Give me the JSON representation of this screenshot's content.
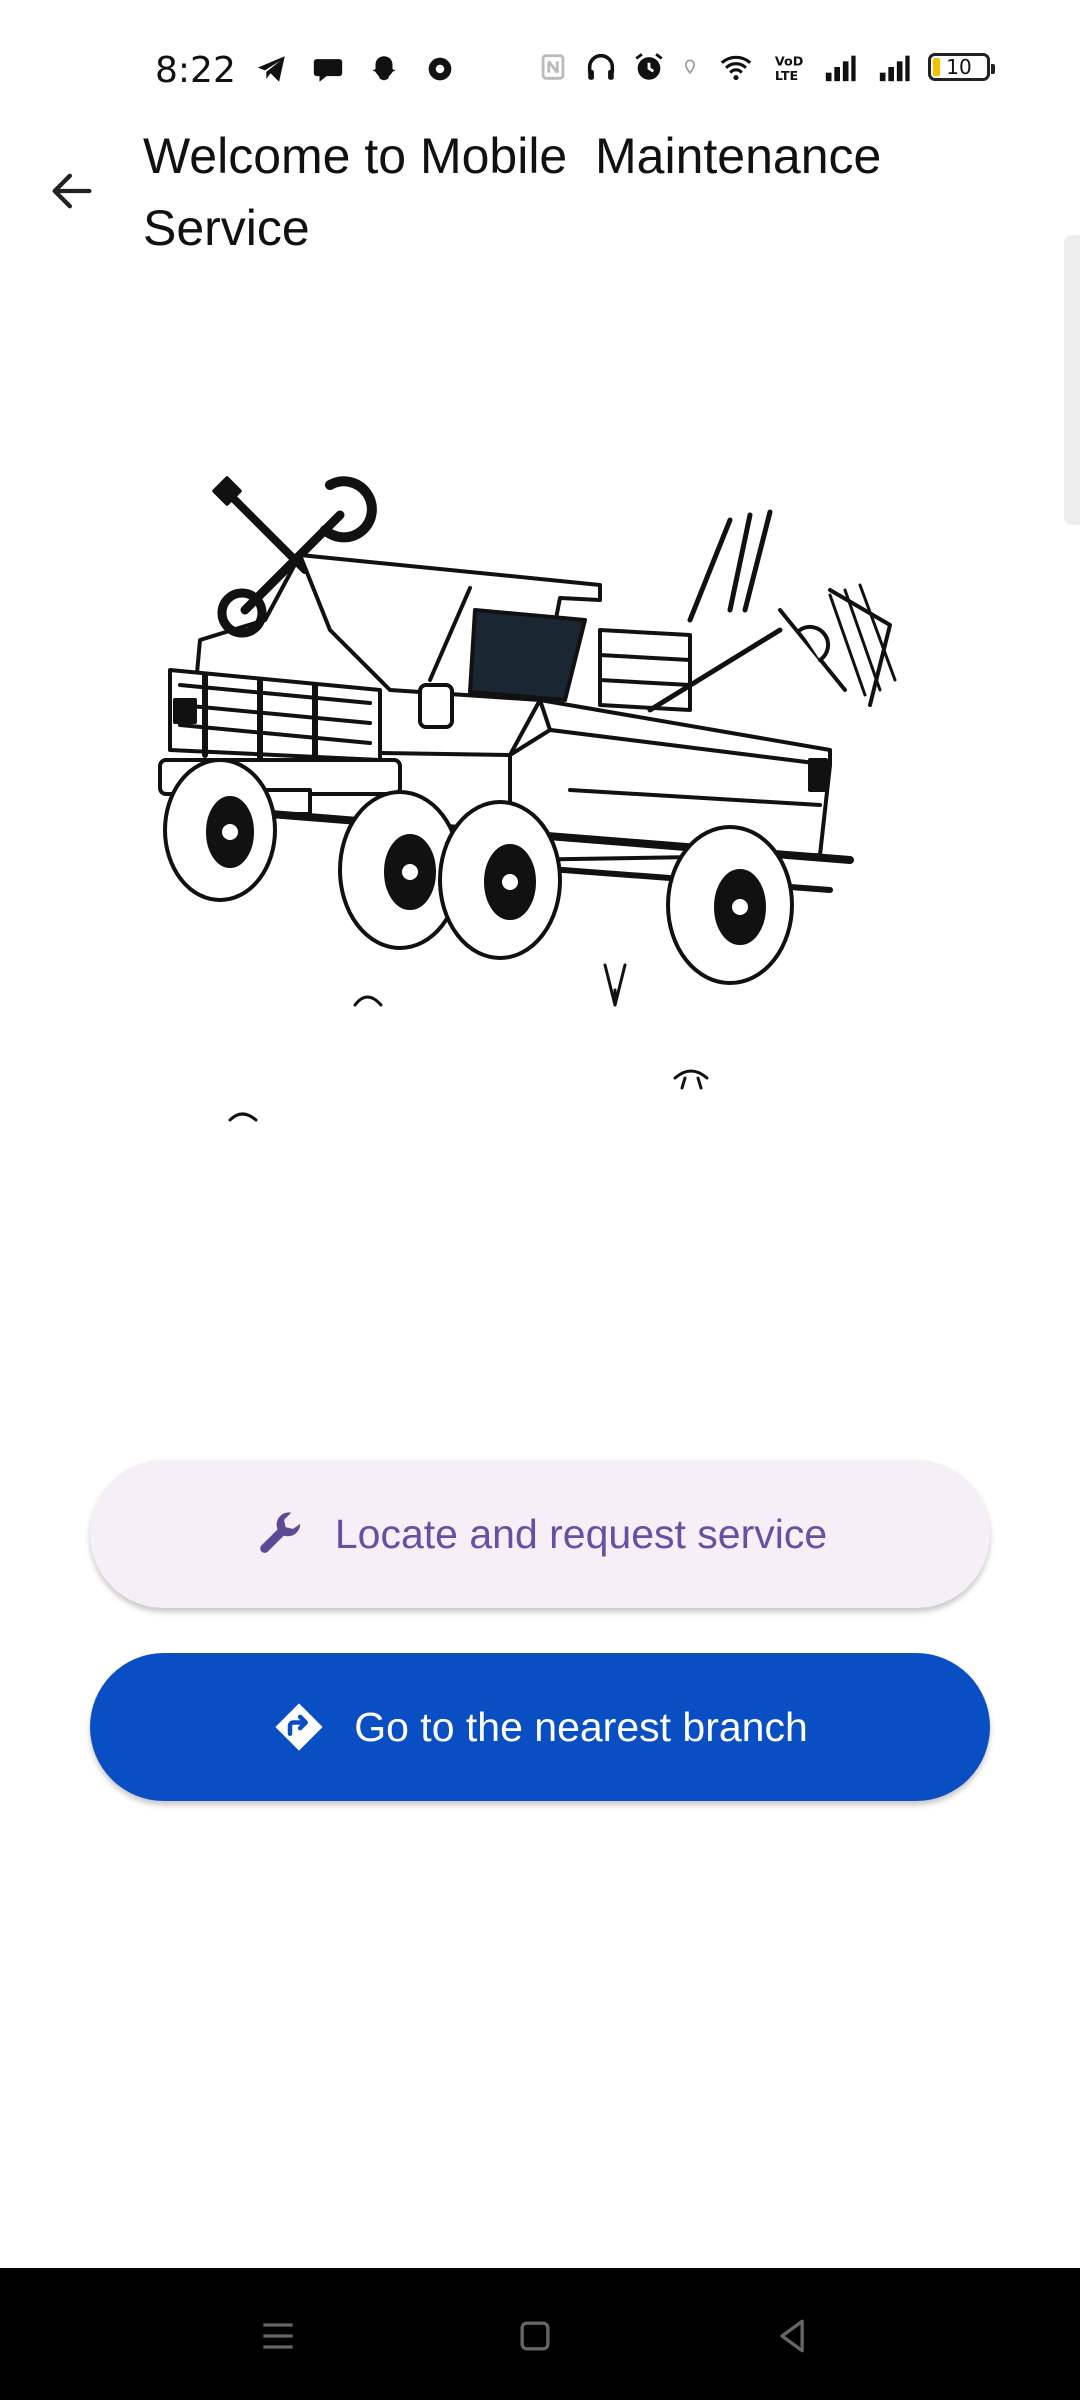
{
  "status_bar": {
    "time": "8:22",
    "battery_level": "10",
    "left_icons": [
      "telegram-icon",
      "chat-bubble-icon",
      "snapchat-icon",
      "app-icon"
    ],
    "right_icons": [
      "nfc-icon",
      "headphones-icon",
      "alarm-icon",
      "location-icon",
      "wifi-icon",
      "volte-icon",
      "signal-icon",
      "signal-icon"
    ],
    "volte_text": "VoD\nLTE"
  },
  "app_bar": {
    "back_icon": "arrow-back-icon",
    "title": "Welcome to Mobile  Maintenance\nService"
  },
  "illustration": {
    "icon": "truck-with-tools-illustration"
  },
  "actions": {
    "locate_label": "Locate and request service",
    "locate_icon": "wrench-icon",
    "branch_label": "Go to the nearest branch",
    "branch_icon": "directions-icon"
  },
  "colors": {
    "primary_button": "#0a4ec4",
    "secondary_button_bg": "#f5f0f8",
    "secondary_button_text": "#6750a4"
  },
  "nav_bar": {
    "items": [
      "menu-icon",
      "home-square-icon",
      "back-triangle-icon"
    ]
  }
}
